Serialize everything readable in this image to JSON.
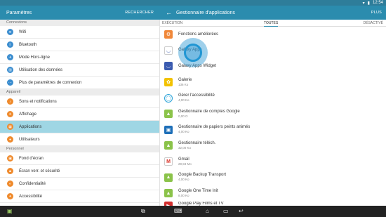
{
  "status": {
    "time": "12:54"
  },
  "left_header": {
    "title": "Paramètres",
    "action": "RECHERCHER"
  },
  "right_header": {
    "title": "Gestionnaire d'applications",
    "action": "PLUS"
  },
  "left_sections": [
    {
      "heading": "Connexions",
      "items": [
        "Wifi",
        "Bluetooth",
        "Mode Hors-ligne",
        "Utilisation des données",
        "Plus de paramètres de connexion"
      ]
    },
    {
      "heading": "Appareil",
      "items": [
        "Sons et notifications",
        "Affichage",
        "Applications",
        "Utilisateurs"
      ]
    },
    {
      "heading": "Personnel",
      "items": [
        "Fond d'écran",
        "Écran verr. et sécurité",
        "Confidentialité",
        "Accessibilité"
      ]
    }
  ],
  "tabs": [
    "EXÉCUTION",
    "TOUTES",
    "DÉSACTIVÉ"
  ],
  "apps": [
    {
      "name": "Fonctions améliorées",
      "size": ""
    },
    {
      "name": "Galaxy Apps",
      "size": ""
    },
    {
      "name": "Galaxy Apps Widget",
      "size": ""
    },
    {
      "name": "Galerie",
      "size": "136 Ko"
    },
    {
      "name": "Gérer l'accessibilité",
      "size": "4,00 Ko"
    },
    {
      "name": "Gestionnaire de comptes Google",
      "size": "0,00 O"
    },
    {
      "name": "Gestionnaire de papiers peints animés",
      "size": "4,00 Ko"
    },
    {
      "name": "Gestionnaire téléch.",
      "size": "32,00 Ko"
    },
    {
      "name": "Gmail",
      "size": "29,94 Mo"
    },
    {
      "name": "Google Backup Transport",
      "size": "4,00 Ko"
    },
    {
      "name": "Google One Time Init",
      "size": "8,00 Ko"
    },
    {
      "name": "Google Play Films et TV",
      "size": ""
    }
  ],
  "colors": {
    "accent": "#2b8cae",
    "selected": "#9fd6e4",
    "section": "#ececec",
    "android_green": "#8bc34a"
  }
}
